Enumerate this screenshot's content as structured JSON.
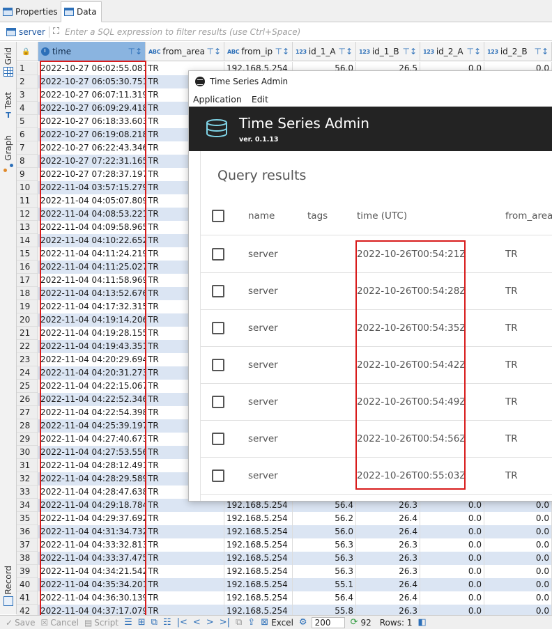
{
  "tabs": [
    {
      "label": "Properties",
      "icon": "table-properties-icon"
    },
    {
      "label": "Data",
      "icon": "table-data-icon"
    }
  ],
  "filter": {
    "entity": "server",
    "placeholder": "Enter a SQL expression to filter results (use Ctrl+Space)"
  },
  "sidebar": {
    "tabs": [
      {
        "label": "Grid",
        "icon": "grid-icon"
      },
      {
        "label": "Text",
        "icon": "text-icon"
      },
      {
        "label": "Graph",
        "icon": "graph-icon"
      },
      {
        "label": "Record",
        "icon": "record-icon"
      }
    ]
  },
  "grid": {
    "columns": [
      {
        "label": "time",
        "type_badge": ""
      },
      {
        "label": "from_area",
        "type_badge": "ABC"
      },
      {
        "label": "from_ip",
        "type_badge": "ABC"
      },
      {
        "label": "id_1_A",
        "type_badge": "123"
      },
      {
        "label": "id_1_B",
        "type_badge": "123"
      },
      {
        "label": "id_2_A",
        "type_badge": "123"
      },
      {
        "label": "id_2_B",
        "type_badge": "123"
      }
    ],
    "rows": [
      [
        "1",
        "2022-10-27 06:02:55.081",
        "TR",
        "192.168.5.254",
        "56.0",
        "26.5",
        "0.0",
        "0.0"
      ],
      [
        "2",
        "2022-10-27 06:05:30.751",
        "TR",
        "",
        "",
        "",
        "",
        ""
      ],
      [
        "3",
        "2022-10-27 06:07:11.319",
        "TR",
        "",
        "",
        "",
        "",
        ""
      ],
      [
        "4",
        "2022-10-27 06:09:29.418",
        "TR",
        "",
        "",
        "",
        "",
        ""
      ],
      [
        "5",
        "2022-10-27 06:18:33.603",
        "TR",
        "",
        "",
        "",
        "",
        ""
      ],
      [
        "6",
        "2022-10-27 06:19:08.218",
        "TR",
        "",
        "",
        "",
        "",
        ""
      ],
      [
        "7",
        "2022-10-27 06:22:43.346",
        "TR",
        "",
        "",
        "",
        "",
        ""
      ],
      [
        "8",
        "2022-10-27 07:22:31.165",
        "TR",
        "",
        "",
        "",
        "",
        ""
      ],
      [
        "9",
        "2022-10-27 07:28:37.197",
        "TR",
        "",
        "",
        "",
        "",
        ""
      ],
      [
        "10",
        "2022-11-04 03:57:15.279",
        "TR",
        "",
        "",
        "",
        "",
        ""
      ],
      [
        "11",
        "2022-11-04 04:05:07.809",
        "TR",
        "",
        "",
        "",
        "",
        ""
      ],
      [
        "12",
        "2022-11-04 04:08:53.221",
        "TR",
        "",
        "",
        "",
        "",
        ""
      ],
      [
        "13",
        "2022-11-04 04:09:58.965",
        "TR",
        "",
        "",
        "",
        "",
        ""
      ],
      [
        "14",
        "2022-11-04 04:10:22.652",
        "TR",
        "",
        "",
        "",
        "",
        ""
      ],
      [
        "15",
        "2022-11-04 04:11:24.219",
        "TR",
        "",
        "",
        "",
        "",
        ""
      ],
      [
        "16",
        "2022-11-04 04:11:25.027",
        "TR",
        "",
        "",
        "",
        "",
        ""
      ],
      [
        "17",
        "2022-11-04 04:11:58.969",
        "TR",
        "",
        "",
        "",
        "",
        ""
      ],
      [
        "18",
        "2022-11-04 04:13:52.676",
        "TR",
        "",
        "",
        "",
        "",
        ""
      ],
      [
        "19",
        "2022-11-04 04:17:32.315",
        "TR",
        "",
        "",
        "",
        "",
        ""
      ],
      [
        "20",
        "2022-11-04 04:19:14.206",
        "TR",
        "",
        "",
        "",
        "",
        ""
      ],
      [
        "21",
        "2022-11-04 04:19:28.155",
        "TR",
        "",
        "",
        "",
        "",
        ""
      ],
      [
        "22",
        "2022-11-04 04:19:43.351",
        "TR",
        "",
        "",
        "",
        "",
        ""
      ],
      [
        "23",
        "2022-11-04 04:20:29.694",
        "TR",
        "",
        "",
        "",
        "",
        ""
      ],
      [
        "24",
        "2022-11-04 04:20:31.273",
        "TR",
        "",
        "",
        "",
        "",
        ""
      ],
      [
        "25",
        "2022-11-04 04:22:15.067",
        "TR",
        "",
        "",
        "",
        "",
        ""
      ],
      [
        "26",
        "2022-11-04 04:22:52.346",
        "TR",
        "",
        "",
        "",
        "",
        ""
      ],
      [
        "27",
        "2022-11-04 04:22:54.398",
        "TR",
        "",
        "",
        "",
        "",
        ""
      ],
      [
        "28",
        "2022-11-04 04:25:39.197",
        "TR",
        "",
        "",
        "",
        "",
        ""
      ],
      [
        "29",
        "2022-11-04 04:27:40.673",
        "TR",
        "",
        "",
        "",
        "",
        ""
      ],
      [
        "30",
        "2022-11-04 04:27:53.556",
        "TR",
        "",
        "",
        "",
        "",
        ""
      ],
      [
        "31",
        "2022-11-04 04:28:12.491",
        "TR",
        "",
        "",
        "",
        "",
        ""
      ],
      [
        "32",
        "2022-11-04 04:28:29.589",
        "TR",
        "",
        "",
        "",
        "",
        ""
      ],
      [
        "33",
        "2022-11-04 04:28:47.638",
        "TR",
        "",
        "",
        "",
        "",
        ""
      ],
      [
        "34",
        "2022-11-04 04:29:18.784",
        "TR",
        "192.168.5.254",
        "56.4",
        "26.3",
        "0.0",
        "0.0"
      ],
      [
        "35",
        "2022-11-04 04:29:37.692",
        "TR",
        "192.168.5.254",
        "56.2",
        "26.4",
        "0.0",
        "0.0"
      ],
      [
        "36",
        "2022-11-04 04:31:34.732",
        "TR",
        "192.168.5.254",
        "56.0",
        "26.4",
        "0.0",
        "0.0"
      ],
      [
        "37",
        "2022-11-04 04:33:32.813",
        "TR",
        "192.168.5.254",
        "56.3",
        "26.3",
        "0.0",
        "0.0"
      ],
      [
        "38",
        "2022-11-04 04:33:37.475",
        "TR",
        "192.168.5.254",
        "56.3",
        "26.3",
        "0.0",
        "0.0"
      ],
      [
        "39",
        "2022-11-04 04:34:21.542",
        "TR",
        "192.168.5.254",
        "56.3",
        "26.3",
        "0.0",
        "0.0"
      ],
      [
        "40",
        "2022-11-04 04:35:34.201",
        "TR",
        "192.168.5.254",
        "55.1",
        "26.4",
        "0.0",
        "0.0"
      ],
      [
        "41",
        "2022-11-04 04:36:30.139",
        "TR",
        "192.168.5.254",
        "56.4",
        "26.4",
        "0.0",
        "0.0"
      ],
      [
        "42",
        "2022-11-04 04:37:17.079",
        "TR",
        "192.168.5.254",
        "55.8",
        "26.3",
        "0.0",
        "0.0"
      ]
    ]
  },
  "statusbar": {
    "save": "Save",
    "cancel": "Cancel",
    "script": "Script",
    "excel": "Excel",
    "fetch_size": "200",
    "refresh_count": "92",
    "rows_label": "Rows: 1"
  },
  "window": {
    "title": "Time Series Admin",
    "menu": [
      "Application",
      "Edit"
    ],
    "app_name": "Time Series Admin",
    "version": "ver. 0.1.13",
    "query_title": "Query results",
    "columns": [
      "name",
      "tags",
      "time (UTC)",
      "from_area"
    ],
    "rows": [
      {
        "name": "server",
        "tags": "",
        "time": "2022-10-26T00:54:21Z",
        "from_area": "TR"
      },
      {
        "name": "server",
        "tags": "",
        "time": "2022-10-26T00:54:28Z",
        "from_area": "TR"
      },
      {
        "name": "server",
        "tags": "",
        "time": "2022-10-26T00:54:35Z",
        "from_area": "TR"
      },
      {
        "name": "server",
        "tags": "",
        "time": "2022-10-26T00:54:42Z",
        "from_area": "TR"
      },
      {
        "name": "server",
        "tags": "",
        "time": "2022-10-26T00:54:49Z",
        "from_area": "TR"
      },
      {
        "name": "server",
        "tags": "",
        "time": "2022-10-26T00:54:56Z",
        "from_area": "TR"
      },
      {
        "name": "server",
        "tags": "",
        "time": "2022-10-26T00:55:03Z",
        "from_area": "TR"
      }
    ]
  },
  "colors": {
    "accent": "#2c6fb8",
    "selected_header": "#8ab4e0",
    "alt_row": "#dbe5f3",
    "highlight_box": "#d81c1c",
    "app_header": "#232323"
  }
}
